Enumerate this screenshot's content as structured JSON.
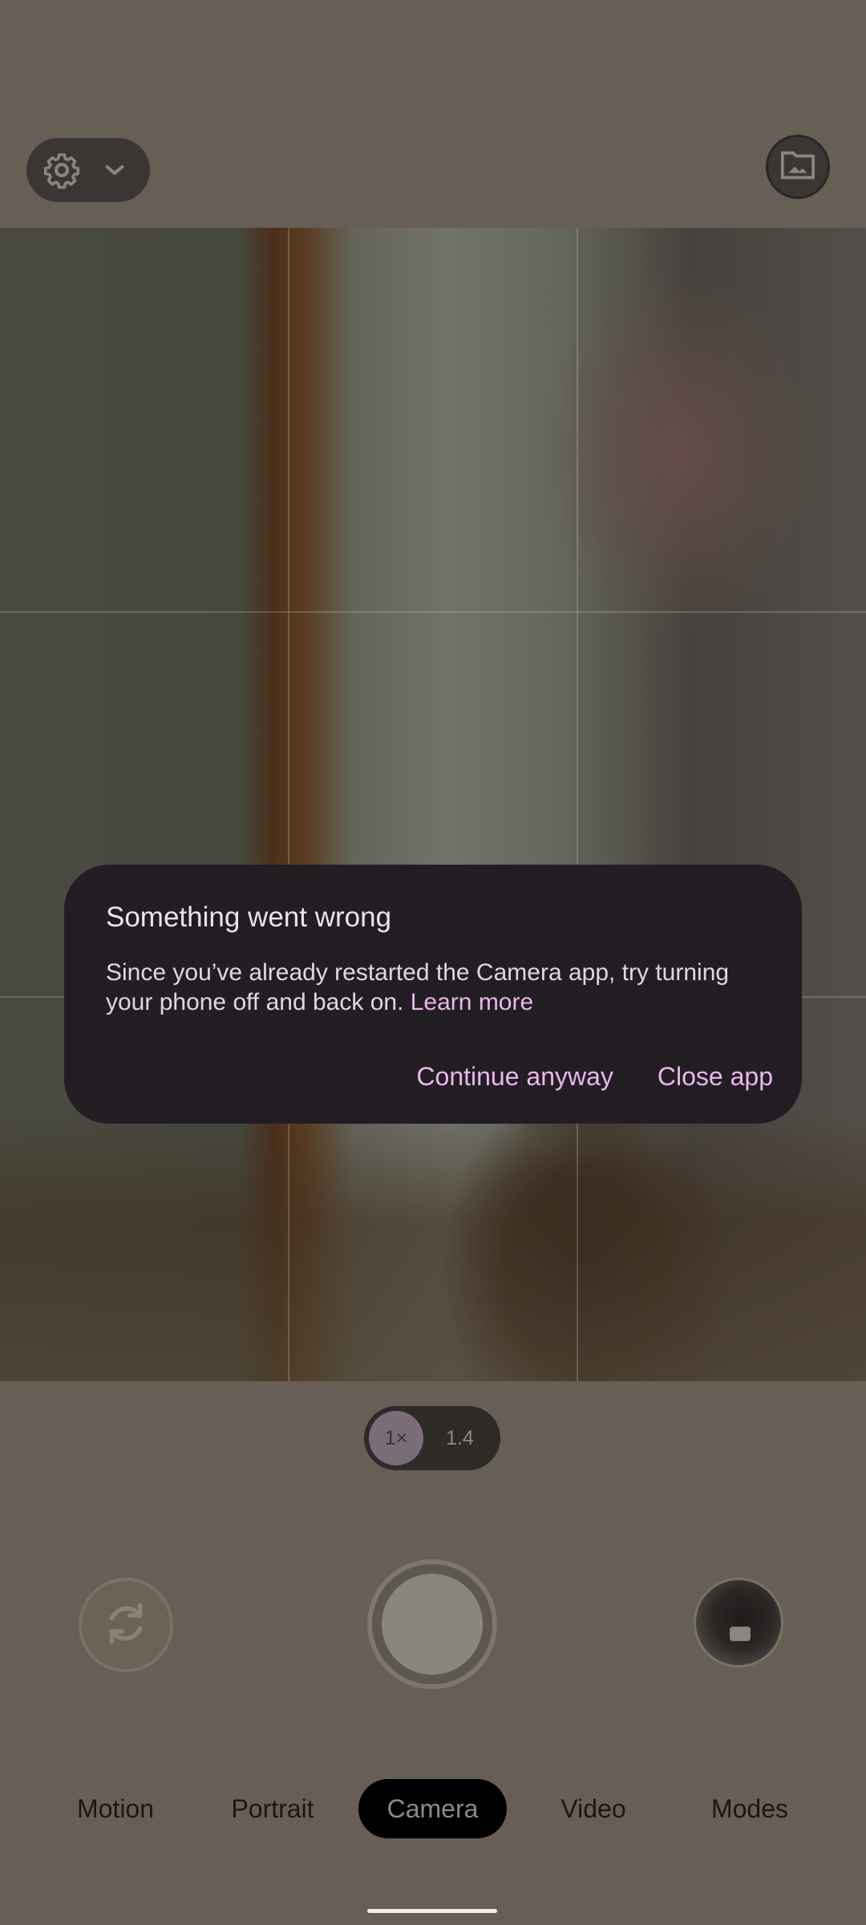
{
  "dialog": {
    "title": "Something went wrong",
    "body": "Since you’ve already restarted the Camera app, try turning your phone off and back on.",
    "link": "Learn more",
    "actions": {
      "continue": "Continue anyway",
      "close": "Close app"
    }
  },
  "zoom": {
    "active": "1×",
    "alternate": "1.4"
  },
  "modes": [
    "Motion",
    "Portrait",
    "Camera",
    "Video",
    "Modes"
  ],
  "selected_mode": "Camera",
  "icons": {
    "settings": "gear-icon",
    "settings_expand": "chevron-down-icon",
    "gallery": "folder-image-icon",
    "flip": "rotate-camera-icon",
    "shutter": "shutter-icon",
    "thumbnail": "last-photo-thumbnail"
  },
  "colors": {
    "accent": "#e8b7ec",
    "dialog_bg": "#221d22",
    "background": "#675e55"
  }
}
